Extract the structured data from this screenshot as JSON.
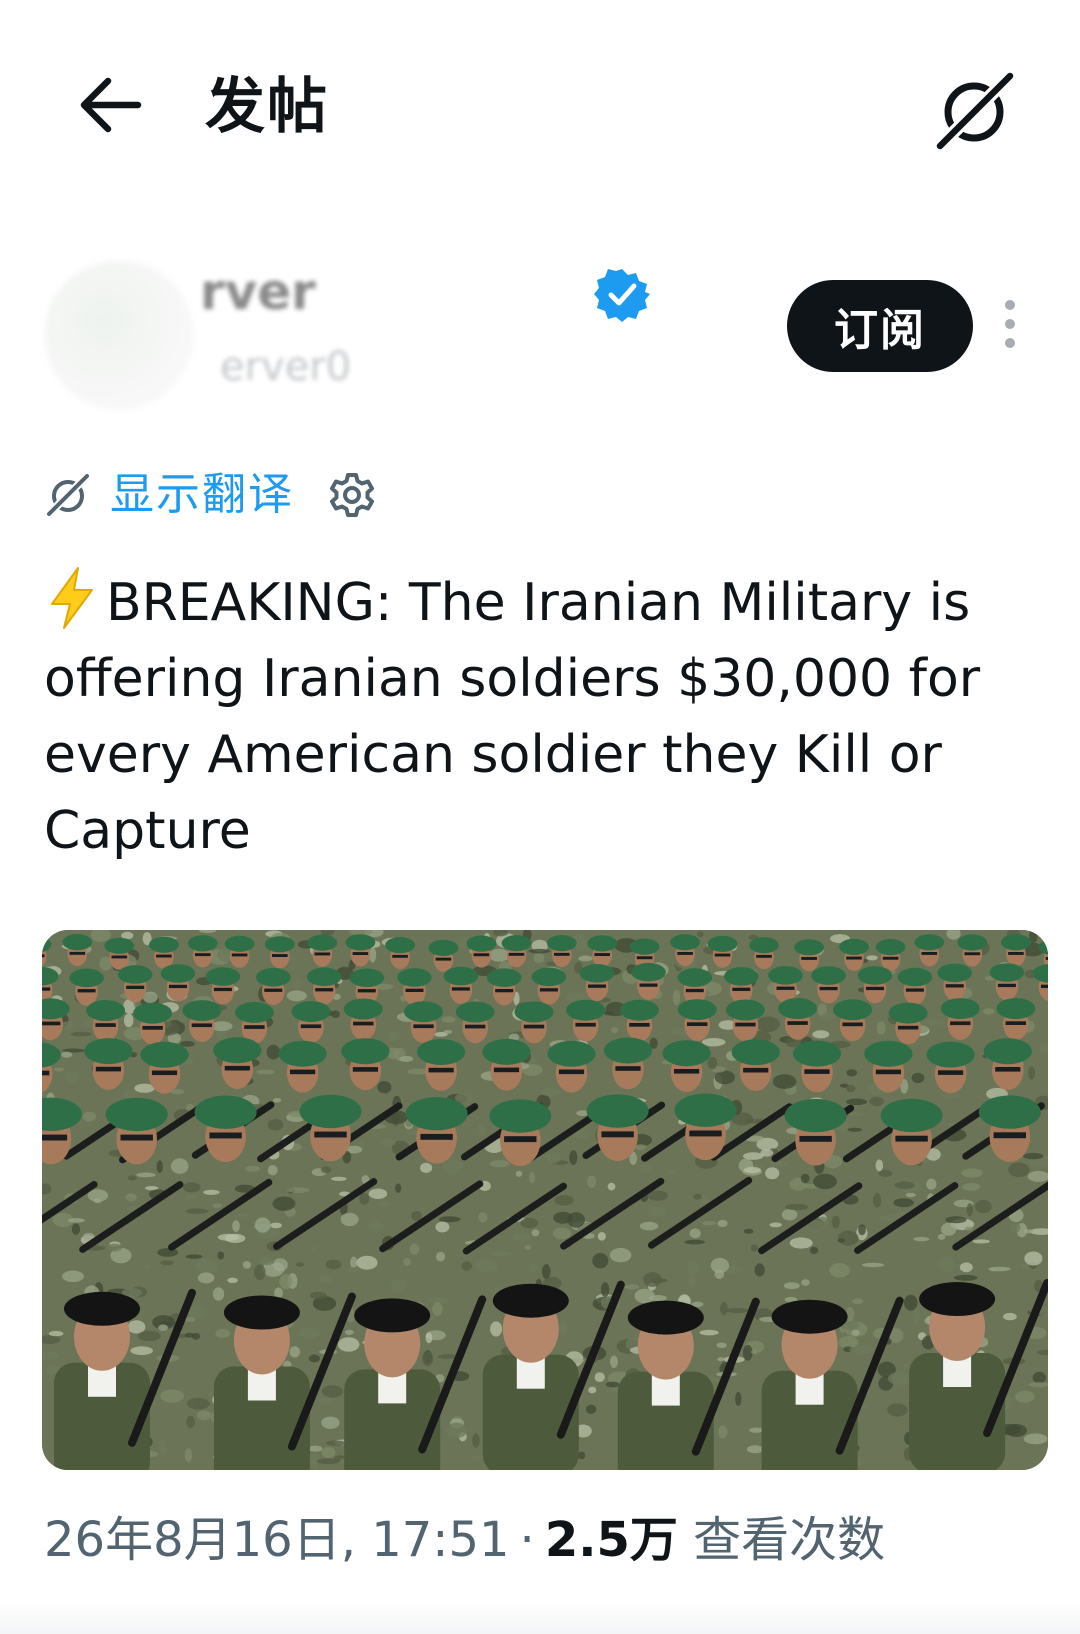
{
  "header": {
    "back_icon": "arrow-left-icon",
    "title": "发帖",
    "grok_icon": "grok-icon"
  },
  "author": {
    "display_name_visible": "rver",
    "verified": true,
    "verified_color": "#1d9bf0",
    "handle_visible": "erver0",
    "subscribe_label": "订阅",
    "more_icon": "more-vertical-icon"
  },
  "translate": {
    "icon": "grok-icon",
    "label": "显示翻译",
    "settings_icon": "gear-icon",
    "color": "#1d9bf0"
  },
  "post": {
    "emoji": "⚡",
    "text": "BREAKING: The Iranian Military is offering Iranian soldiers $30,000 for every American soldier they Kill or Capture",
    "media_alt": "photo"
  },
  "meta": {
    "date_time": "26年8月16日, 17:51",
    "separator": "·",
    "views_count": "2.5万",
    "views_label": "查看次数"
  }
}
